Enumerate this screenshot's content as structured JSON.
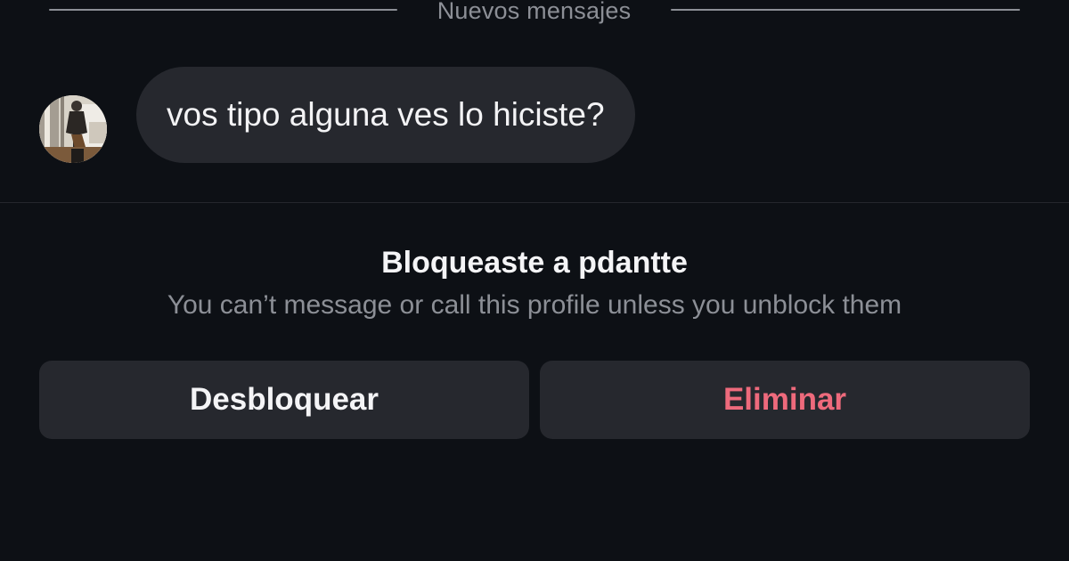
{
  "divider": {
    "label": "Nuevos mensajes"
  },
  "message": {
    "text": "vos tipo alguna ves lo hiciste?"
  },
  "blocked": {
    "title": "Bloqueaste a pdantte",
    "subtitle": "You can’t message or call this profile unless you unblock them"
  },
  "actions": {
    "unblock_label": "Desbloquear",
    "delete_label": "Eliminar"
  },
  "colors": {
    "background": "#0d1015",
    "bubble": "#26282e",
    "muted_text": "#8c8f96",
    "danger": "#ee6a7c"
  },
  "icons": {
    "avatar": "user-avatar-photo"
  }
}
